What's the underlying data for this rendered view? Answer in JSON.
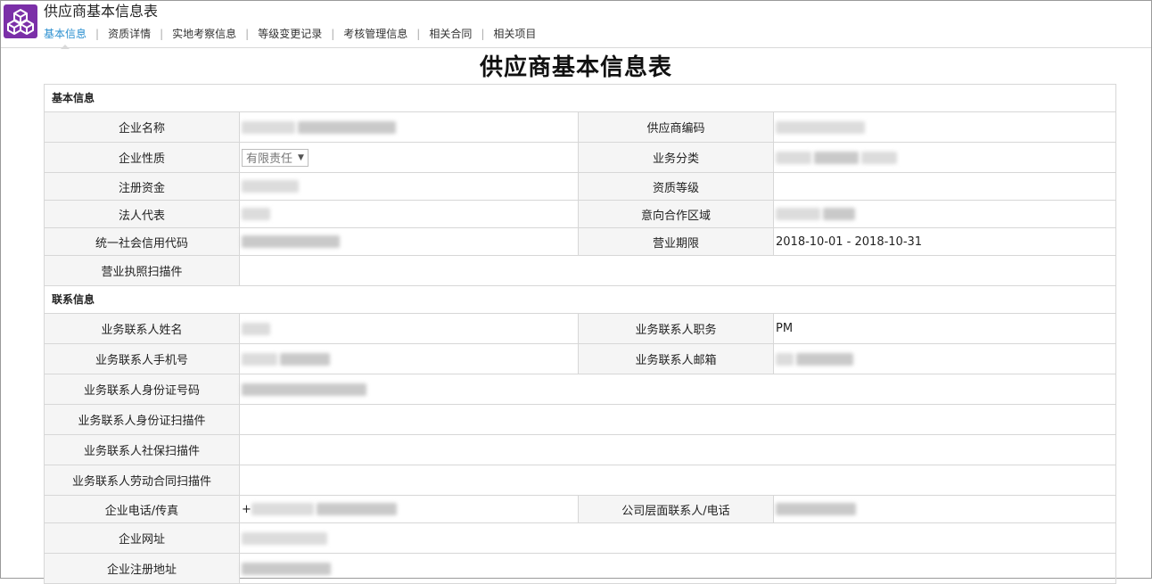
{
  "app": {
    "title": "供应商基本信息表",
    "icon": "cube-stack-icon",
    "accent": "#7b2fa8",
    "link_color": "#2a8fd0"
  },
  "tabs": [
    {
      "label": "基本信息",
      "active": true
    },
    {
      "label": "资质详情",
      "active": false
    },
    {
      "label": "实地考察信息",
      "active": false
    },
    {
      "label": "等级变更记录",
      "active": false
    },
    {
      "label": "考核管理信息",
      "active": false
    },
    {
      "label": "相关合同",
      "active": false
    },
    {
      "label": "相关项目",
      "active": false
    }
  ],
  "tab_separator": "|",
  "page": {
    "title": "供应商基本信息表"
  },
  "sections": {
    "basic": {
      "title": "基本信息",
      "company_name": "企业名称",
      "supplier_code": "供应商编码",
      "company_type": "企业性质",
      "company_type_value": "有限责任",
      "business_category": "业务分类",
      "registered_capital": "注册资金",
      "qualification_level": "资质等级",
      "legal_rep": "法人代表",
      "intended_region": "意向合作区域",
      "credit_code": "统一社会信用代码",
      "business_term": "营业期限",
      "business_term_value": "2018-10-01 - 2018-10-31",
      "license_scan": "营业执照扫描件"
    },
    "contact": {
      "title": "联系信息",
      "contact_name": "业务联系人姓名",
      "contact_title": "业务联系人职务",
      "contact_title_value": "PM",
      "contact_phone": "业务联系人手机号",
      "contact_email": "业务联系人邮箱",
      "contact_id": "业务联系人身份证号码",
      "contact_id_scan": "业务联系人身份证扫描件",
      "contact_social_scan": "业务联系人社保扫描件",
      "contact_contract_scan": "业务联系人劳动合同扫描件",
      "company_phone_fax": "企业电话/传真",
      "company_phone_prefix": "+",
      "company_level_contact": "公司层面联系人/电话",
      "company_website": "企业网址",
      "company_address": "企业注册地址"
    }
  }
}
